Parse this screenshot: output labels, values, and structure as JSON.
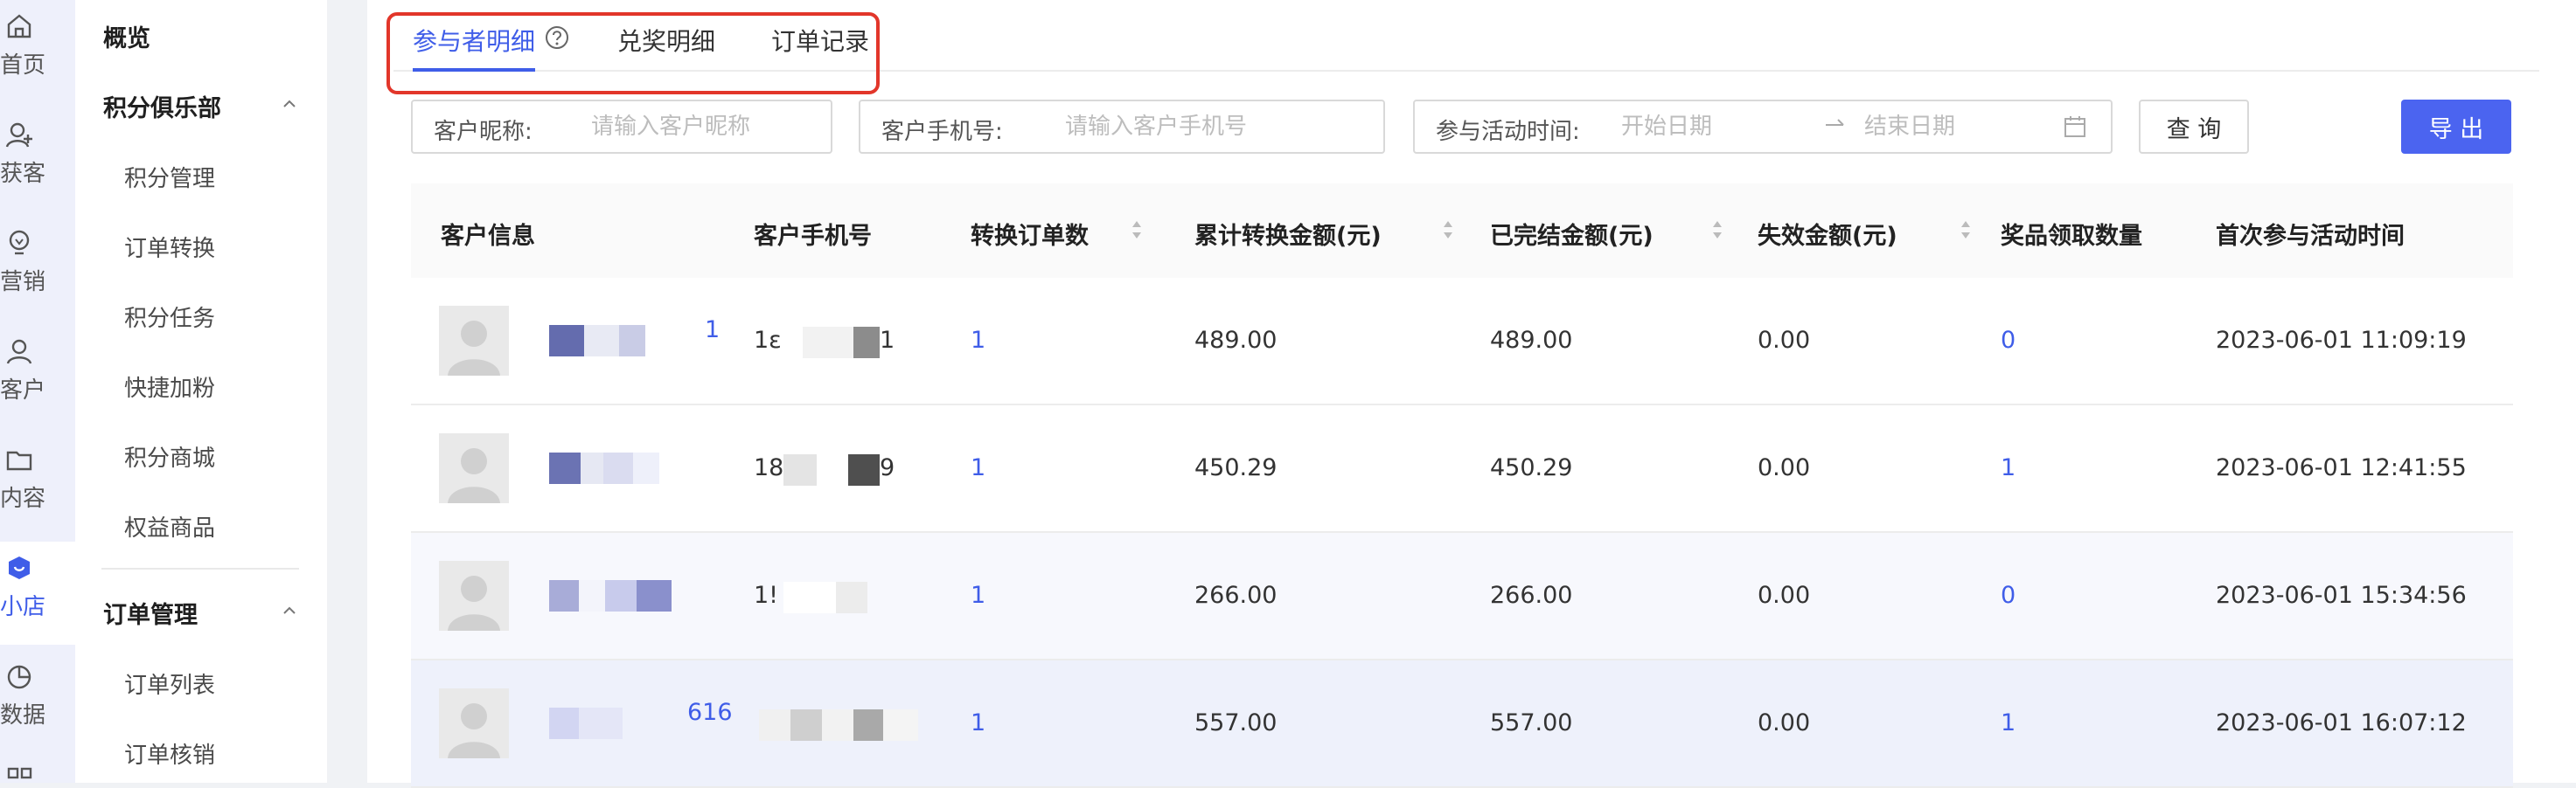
{
  "rail": {
    "items": [
      {
        "label": "首页",
        "icon": "home-icon"
      },
      {
        "label": "获客",
        "icon": "user-add-icon"
      },
      {
        "label": "营销",
        "icon": "bulb-icon"
      },
      {
        "label": "客户",
        "icon": "user-icon"
      },
      {
        "label": "内容",
        "icon": "folder-icon"
      },
      {
        "label": "小店",
        "icon": "shop-icon",
        "active": true
      },
      {
        "label": "数据",
        "icon": "pie-chart-icon"
      }
    ]
  },
  "menu": {
    "overview": "概览",
    "group1": {
      "title": "积分俱乐部",
      "items": [
        "积分管理",
        "订单转换",
        "积分任务",
        "快捷加粉",
        "积分商城",
        "权益商品"
      ]
    },
    "group2": {
      "title": "订单管理",
      "items": [
        "订单列表",
        "订单核销"
      ]
    }
  },
  "tabs": [
    {
      "label": "参与者明细",
      "active": true
    },
    {
      "label": "兑奖明细"
    },
    {
      "label": "订单记录"
    }
  ],
  "filters": {
    "nickname": {
      "label": "客户昵称:",
      "placeholder": "请输入客户昵称"
    },
    "phone": {
      "label": "客户手机号:",
      "placeholder": "请输入客户手机号"
    },
    "time": {
      "label": "参与活动时间:",
      "start_placeholder": "开始日期",
      "end_placeholder": "结束日期"
    },
    "query_label": "查 询",
    "export_label": "导 出"
  },
  "table": {
    "columns": [
      "客户信息",
      "客户手机号",
      "转换订单数",
      "累计转换金额(元)",
      "已完结金额(元)",
      "失效金额(元)",
      "奖品领取数量",
      "首次参与活动时间"
    ],
    "rows": [
      {
        "nick_tail": "1",
        "phone_prefix": "1ε",
        "phone_tail": "1",
        "orders": "1",
        "total": "489.00",
        "settled": "489.00",
        "invalid": "0.00",
        "prizes": "0",
        "first_time": "2023-06-01 11:09:19"
      },
      {
        "nick_tail": "",
        "phone_prefix": "18",
        "phone_tail": "9",
        "orders": "1",
        "total": "450.29",
        "settled": "450.29",
        "invalid": "0.00",
        "prizes": "1",
        "first_time": "2023-06-01 12:41:55"
      },
      {
        "nick_tail": "",
        "phone_prefix": "1!",
        "phone_tail": "",
        "orders": "1",
        "total": "266.00",
        "settled": "266.00",
        "invalid": "0.00",
        "prizes": "0",
        "first_time": "2023-06-01 15:34:56"
      },
      {
        "nick_tail": "616",
        "phone_prefix": "",
        "phone_tail": "",
        "orders": "1",
        "total": "557.00",
        "settled": "557.00",
        "invalid": "0.00",
        "prizes": "1",
        "first_time": "2023-06-01 16:07:12"
      }
    ]
  },
  "colors": {
    "accent": "#3f5de8",
    "highlight_outline": "#e2362a",
    "export_button": "#4b64f0"
  }
}
